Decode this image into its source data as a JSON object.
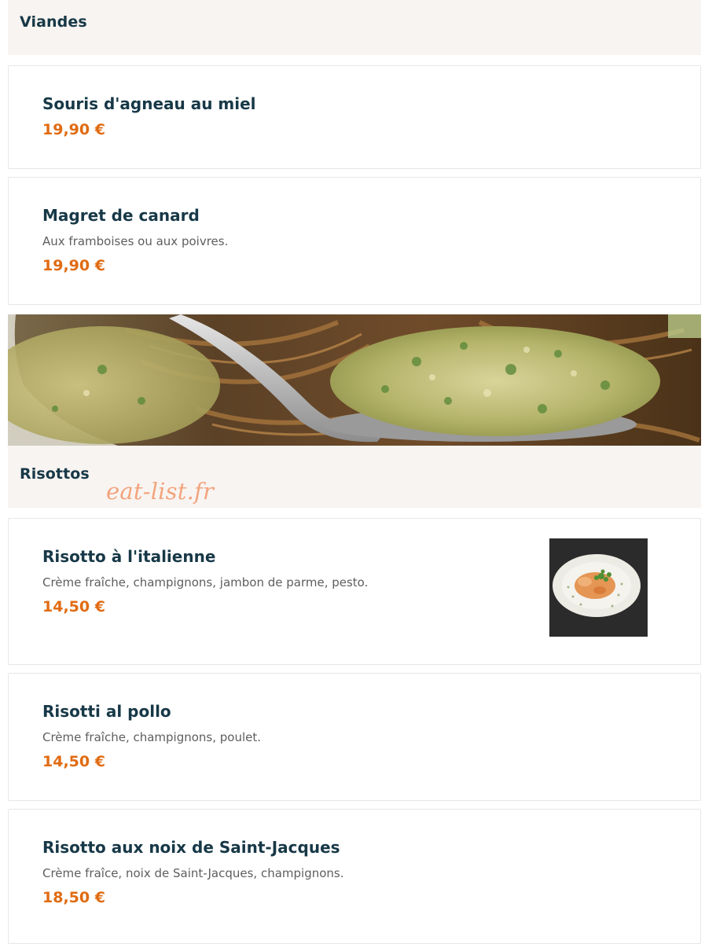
{
  "sections": {
    "viandes": {
      "title": "Viandes",
      "items": [
        {
          "name": "Souris d'agneau au miel",
          "price": "19,90 €"
        },
        {
          "name": "Magret de canard",
          "description": "Aux framboises ou aux poivres.",
          "price": "19,90 €"
        }
      ]
    },
    "risottos": {
      "title": "Risottos",
      "items": [
        {
          "name": "Risotto à l'italienne",
          "description": "Crème fraîche, champignons, jambon de parme, pesto.",
          "price": "14,50 €"
        },
        {
          "name": "Risotti al pollo",
          "description": "Crème fraîche, champignons, poulet.",
          "price": "14,50 €"
        },
        {
          "name": "Risotto aux noix de Saint-Jacques",
          "description": "Crème fraîce, noix de Saint-Jacques, champignons.",
          "price": "18,50 €"
        }
      ]
    }
  },
  "watermark": "eat-list.fr",
  "colors": {
    "heading": "#173847",
    "price": "#e06b12",
    "section_background": "#f8f4f1",
    "watermark": "#f2a47d"
  },
  "icons": {
    "banner": "risotto-spoon-photo",
    "dish_thumbnail": "risotto-plate-photo"
  }
}
